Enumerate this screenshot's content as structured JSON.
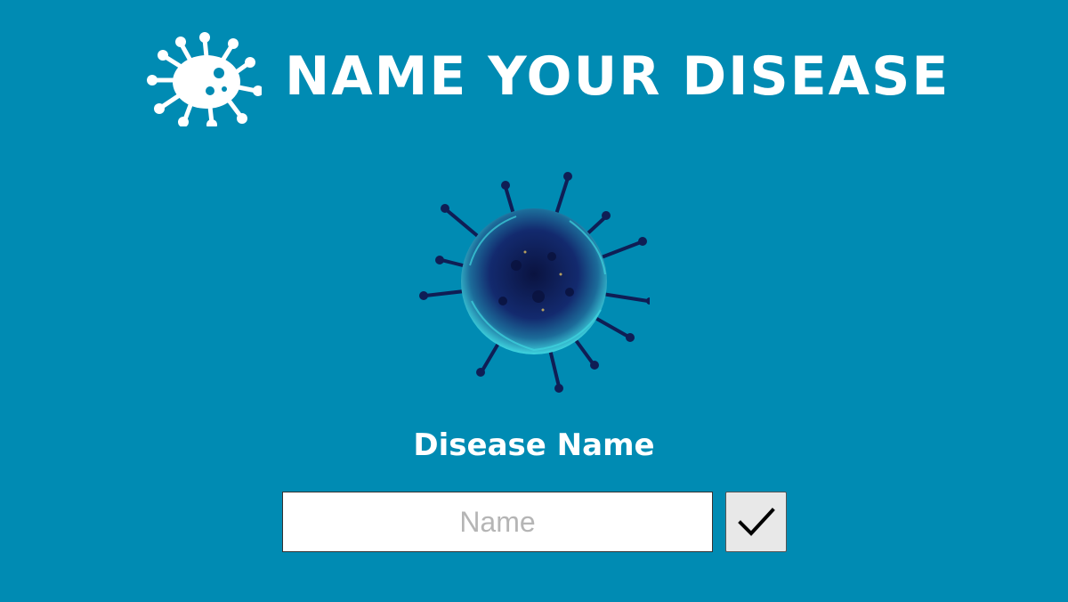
{
  "header": {
    "title": "NAME YOUR DISEASE",
    "logo_icon": "virus-icon"
  },
  "illustration": {
    "icon": "virus-illustration"
  },
  "form": {
    "label": "Disease Name",
    "name_value": "",
    "name_placeholder": "Name",
    "confirm_icon": "checkmark-icon"
  },
  "colors": {
    "background": "#008bb3",
    "text": "#ffffff",
    "virus_dark": "#0f1e55",
    "virus_cyan": "#3fd6e0"
  }
}
